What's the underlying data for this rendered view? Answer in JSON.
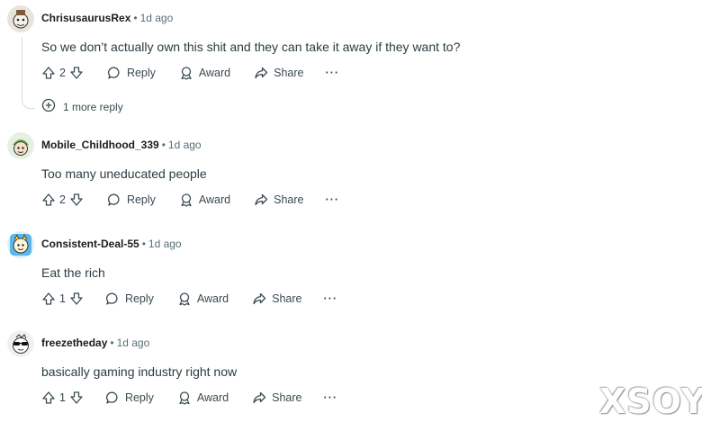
{
  "comments": [
    {
      "username": "ChrisusaurusRex",
      "age": "1d ago",
      "body": "So we don’t actually own this shit and they can take it away if they want to?",
      "votes": "2",
      "more_replies": "1 more reply"
    },
    {
      "username": "Mobile_Childhood_339",
      "age": "1d ago",
      "body": "Too many uneducated people",
      "votes": "2"
    },
    {
      "username": "Consistent-Deal-55",
      "age": "1d ago",
      "body": "Eat the rich",
      "votes": "1"
    },
    {
      "username": "freezetheday",
      "age": "1d ago",
      "body": "basically gaming industry right now",
      "votes": "1"
    }
  ],
  "actions": {
    "separator": "•",
    "reply": "Reply",
    "award": "Award",
    "share": "Share",
    "overflow": "···"
  },
  "watermark": "XSOYO",
  "icons": [
    "avatar",
    "upvote-icon",
    "downvote-icon",
    "reply-icon",
    "award-icon",
    "share-icon",
    "more-icon",
    "add-circle-icon"
  ],
  "colors": {
    "text": "#1c1c1c",
    "muted": "#576f76",
    "thread_line": "#d6dde0"
  }
}
